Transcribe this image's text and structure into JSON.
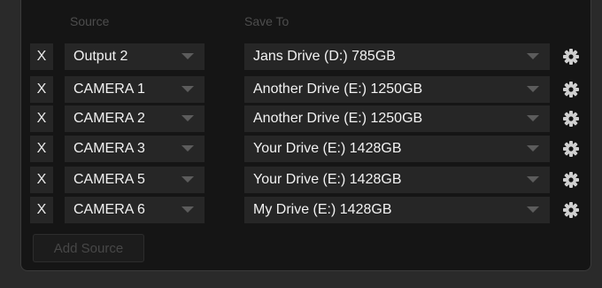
{
  "headers": {
    "source": "Source",
    "save_to": "Save To"
  },
  "rows": [
    {
      "remove_label": "X",
      "source": "Output 2",
      "destination": "Jans Drive (D:) 785GB"
    },
    {
      "remove_label": "X",
      "source": "CAMERA 1",
      "destination": "Another Drive (E:) 1250GB"
    },
    {
      "remove_label": "X",
      "source": "CAMERA 2",
      "destination": "Another Drive (E:) 1250GB"
    },
    {
      "remove_label": "X",
      "source": "CAMERA 3",
      "destination": "Your Drive (E:) 1428GB"
    },
    {
      "remove_label": "X",
      "source": "CAMERA 5",
      "destination": "Your Drive (E:) 1428GB"
    },
    {
      "remove_label": "X",
      "source": "CAMERA 6",
      "destination": "My Drive (E:) 1428GB"
    }
  ],
  "add_source_label": "Add Source",
  "icons": {
    "row_settings": "gear-icon",
    "dropdown": "chevron-down-icon"
  }
}
